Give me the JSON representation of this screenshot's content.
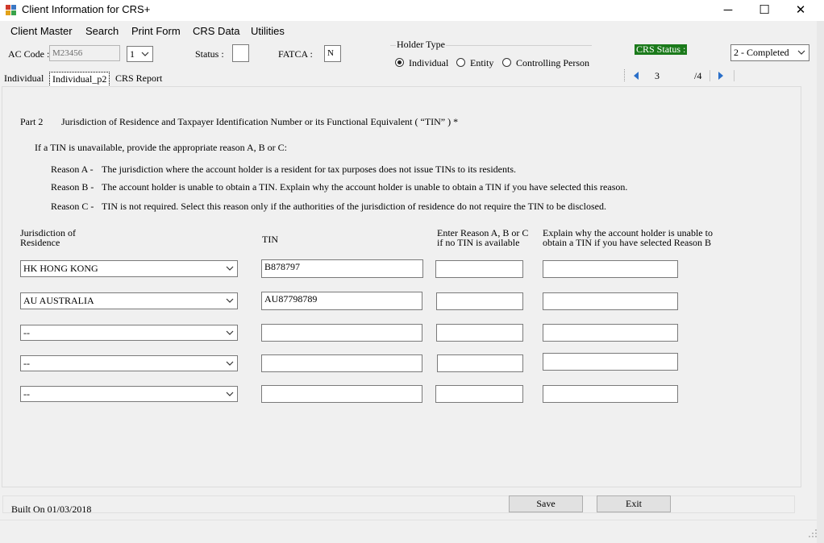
{
  "window": {
    "title": "Client Information for CRS+",
    "minimize_glyph": "─",
    "maximize_glyph": "☐",
    "close_glyph": "✕"
  },
  "menu": [
    "Client Master",
    "Search",
    "Print Form",
    "CRS Data",
    "Utilities"
  ],
  "header": {
    "ac_code_label": "AC Code :",
    "ac_code_value": "M23456",
    "ac_seq_value": "1",
    "status_label": "Status :",
    "status_value": "",
    "fatca_label": "FATCA :",
    "fatca_value": "N",
    "holder_type_label": "Holder Type",
    "holder_types": [
      {
        "label": "Individual",
        "checked": true
      },
      {
        "label": "Entity",
        "checked": false
      },
      {
        "label": "Controlling Person",
        "checked": false
      }
    ],
    "crs_status_label": "CRS Status :",
    "crs_status_value": "2 - Completed",
    "crs_status_color": "#1b7a1b",
    "page_current": "3",
    "page_total": "/4"
  },
  "tabs": [
    "Individual",
    "Individual_p2",
    "CRS Report"
  ],
  "part2": {
    "part_label": "Part 2",
    "heading": "Jurisdiction of Residence and Taxpayer Identification Number or its Functional Equivalent ( “TIN” ) *",
    "intro": "If a TIN is unavailable, provide the appropriate reason A, B or C:",
    "reasons": [
      {
        "key": "Reason A  -",
        "text": "The jurisdiction where the account holder is a resident for tax purposes does not issue TINs to its residents."
      },
      {
        "key": "Reason B  -",
        "text": "The account holder is unable to obtain a TIN. Explain why the account holder is unable to obtain a TIN if you have selected this reason."
      },
      {
        "key": "Reason C  -",
        "text": "TIN is not required. Select this reason only if the authorities of the jurisdiction of residence do not require the TIN to be disclosed."
      }
    ],
    "columns": {
      "jurisdiction_l1": "Jurisdiction of",
      "jurisdiction_l2": "Residence",
      "tin": "TIN",
      "reason_l1": "Enter Reason A, B or C",
      "reason_l2": "if no TIN is available",
      "explain_l1": "Explain why the account holder is unable to",
      "explain_l2": "obtain a TIN if you have selected Reason B"
    },
    "rows": [
      {
        "jurisdiction": "HK  HONG KONG",
        "tin": "B878797",
        "reason": "",
        "explain": ""
      },
      {
        "jurisdiction": "AU  AUSTRALIA",
        "tin": "AU87798789",
        "reason": "",
        "explain": ""
      },
      {
        "jurisdiction": "--",
        "tin": "",
        "reason": "",
        "explain": ""
      },
      {
        "jurisdiction": "--",
        "tin": "",
        "reason": "",
        "explain": ""
      },
      {
        "jurisdiction": "--",
        "tin": "",
        "reason": "",
        "explain": ""
      }
    ]
  },
  "footer": {
    "built_on": "Built On  01/03/2018",
    "save_label": "Save",
    "exit_label": "Exit"
  }
}
